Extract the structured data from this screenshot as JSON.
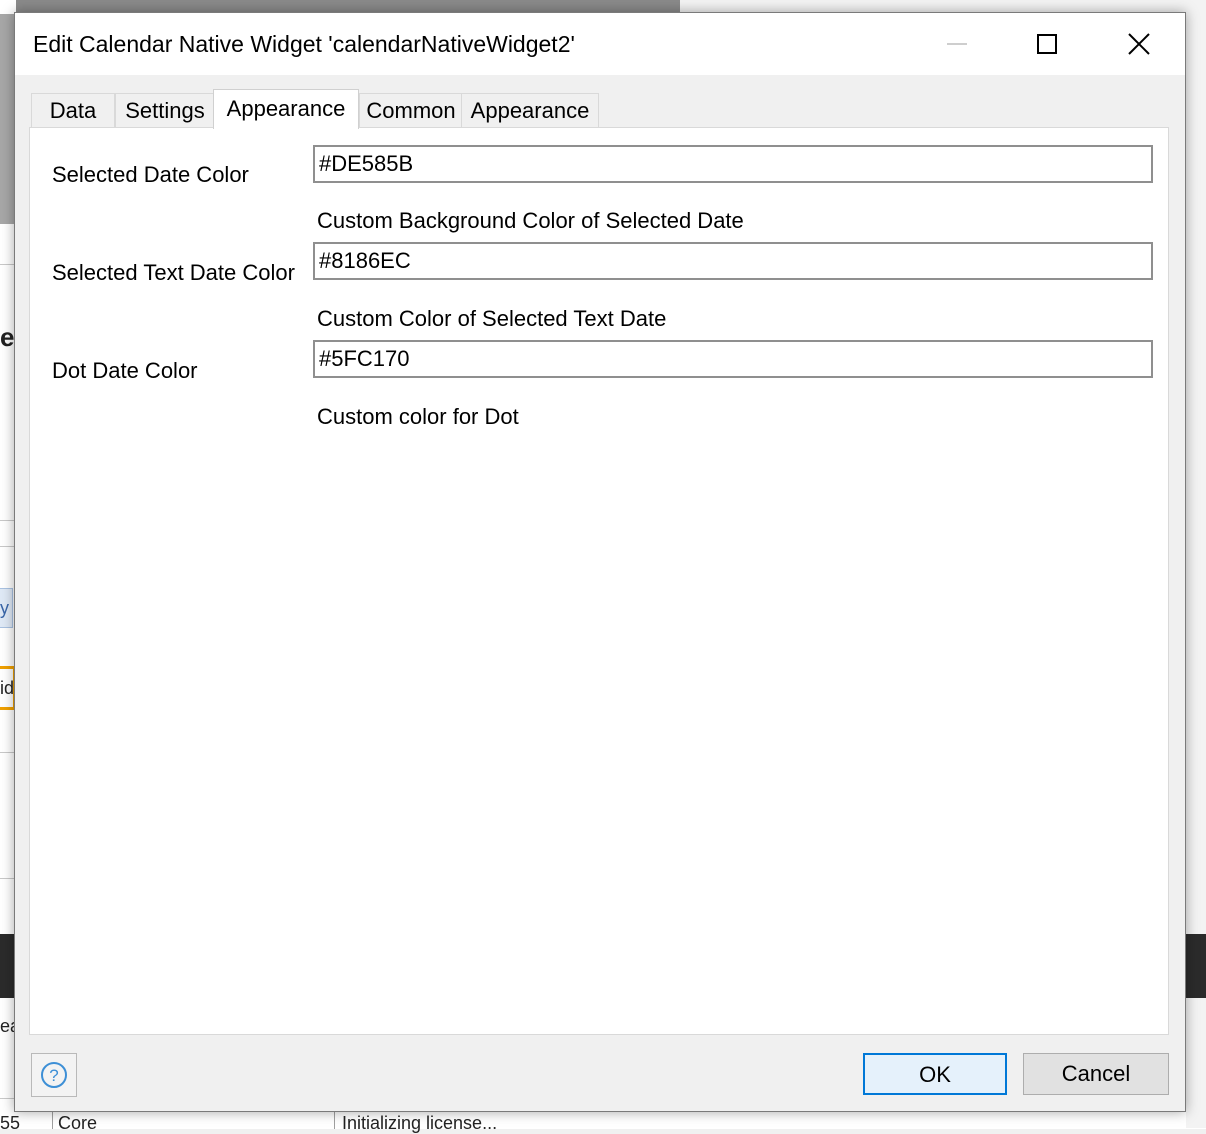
{
  "dialog": {
    "title": "Edit Calendar Native Widget 'calendarNativeWidget2'",
    "tabs": [
      {
        "label": "Data"
      },
      {
        "label": "Settings"
      },
      {
        "label": "Appearance",
        "active": true
      },
      {
        "label": "Common"
      },
      {
        "label": "Appearance"
      }
    ],
    "fields": [
      {
        "label": "Selected Date Color",
        "value": "#DE585B",
        "description": "Custom Background Color of Selected Date"
      },
      {
        "label": "Selected Text Date Color",
        "value": "#8186EC",
        "description": "Custom Color of Selected Text Date"
      },
      {
        "label": "Dot Date Color",
        "value": "#5FC170",
        "description": "Custom color for Dot"
      }
    ],
    "buttons": {
      "ok": "OK",
      "cancel": "Cancel",
      "help_icon": "help-icon"
    },
    "colors": {
      "accent": "#0078d7"
    }
  },
  "background": {
    "letters": [
      "e",
      "y",
      "id",
      "ea"
    ],
    "status": {
      "col1": "55",
      "col2": "Core",
      "col3": "Initializing license..."
    }
  }
}
